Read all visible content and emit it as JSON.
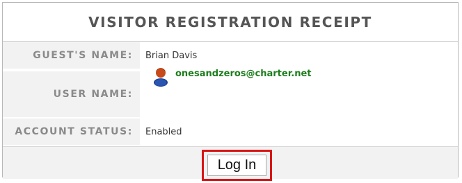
{
  "title": "VISITOR REGISTRATION RECEIPT",
  "fields": {
    "guest_name": {
      "label": "GUEST'S NAME:",
      "value": "Brian Davis"
    },
    "user_name": {
      "label": "USER NAME:",
      "value": "onesandzeros@charter.net",
      "icon": "person-avatar-icon"
    },
    "account_status": {
      "label": "ACCOUNT STATUS:",
      "value": "Enabled"
    }
  },
  "actions": {
    "login_label": "Log In"
  },
  "colors": {
    "email": "#1d7d1d",
    "highlight": "#d91515",
    "label": "#8a8a8a",
    "label_bg": "#f2f2f2"
  }
}
